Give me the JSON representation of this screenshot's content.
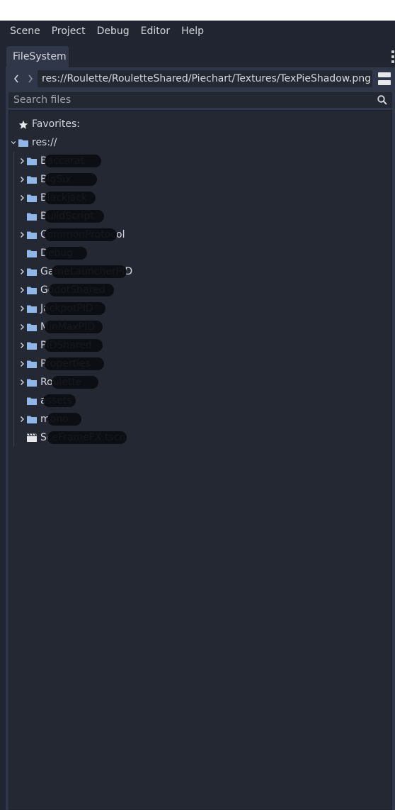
{
  "menu": [
    "Scene",
    "Project",
    "Debug",
    "Editor",
    "Help"
  ],
  "tab": {
    "label": "FileSystem"
  },
  "path": {
    "value": "res://Roulette/RouletteShared/Piechart/Textures/TexPieShadow.png"
  },
  "search": {
    "placeholder": "Search files"
  },
  "tree": {
    "favorites_label": "Favorites:",
    "root_label": "res://",
    "items": [
      {
        "label": "Baccarat",
        "type": "folder",
        "expandable": true,
        "redacted": true
      },
      {
        "label": "BigSix",
        "type": "folder",
        "expandable": true,
        "redacted": true
      },
      {
        "label": "Blackjack",
        "type": "folder",
        "expandable": true,
        "redacted": true
      },
      {
        "label": "BuildScript",
        "type": "folder",
        "expandable": false,
        "redacted": true
      },
      {
        "label": "CommonProtocol",
        "type": "folder",
        "expandable": true,
        "redacted": true
      },
      {
        "label": "Debug",
        "type": "folder",
        "expandable": false,
        "redacted": true
      },
      {
        "label": "GameLauncherPID",
        "type": "folder",
        "expandable": true,
        "redacted": true
      },
      {
        "label": "GodotShared",
        "type": "folder",
        "expandable": true,
        "redacted": true
      },
      {
        "label": "JackpotPID",
        "type": "folder",
        "expandable": true,
        "redacted": true
      },
      {
        "label": "MinMaxPID",
        "type": "folder",
        "expandable": true,
        "redacted": true
      },
      {
        "label": "PIDShared",
        "type": "folder",
        "expandable": true,
        "redacted": true
      },
      {
        "label": "Properties",
        "type": "folder",
        "expandable": true,
        "redacted": true
      },
      {
        "label": "Roulette",
        "type": "folder",
        "expandable": true,
        "redacted": true
      },
      {
        "label": "assets",
        "type": "folder",
        "expandable": false,
        "redacted": true
      },
      {
        "label": "mono",
        "type": "folder",
        "expandable": true,
        "redacted": true
      },
      {
        "label": "SceFrameFX.tscn",
        "type": "scene",
        "expandable": false,
        "redacted": true
      }
    ]
  },
  "colors": {
    "folder": "#8fb8e8",
    "background": "#202531",
    "panel": "#303748",
    "tree": "#232833"
  }
}
